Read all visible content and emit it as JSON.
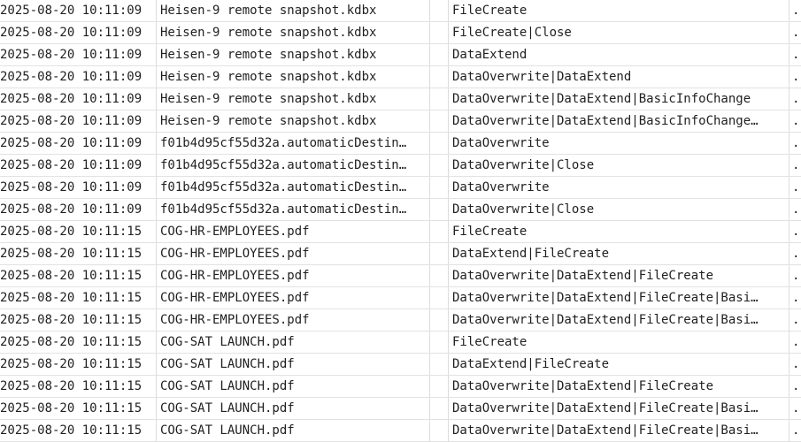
{
  "rows": [
    {
      "time": "2025-08-20 10:11:09",
      "file": "Heisen-9 remote snapshot.kdbx",
      "reason": "FileCreate",
      "more": "."
    },
    {
      "time": "2025-08-20 10:11:09",
      "file": "Heisen-9 remote snapshot.kdbx",
      "reason": "FileCreate|Close",
      "more": "."
    },
    {
      "time": "2025-08-20 10:11:09",
      "file": "Heisen-9 remote snapshot.kdbx",
      "reason": "DataExtend",
      "more": "."
    },
    {
      "time": "2025-08-20 10:11:09",
      "file": "Heisen-9 remote snapshot.kdbx",
      "reason": "DataOverwrite|DataExtend",
      "more": "."
    },
    {
      "time": "2025-08-20 10:11:09",
      "file": "Heisen-9 remote snapshot.kdbx",
      "reason": "DataOverwrite|DataExtend|BasicInfoChange",
      "more": "."
    },
    {
      "time": "2025-08-20 10:11:09",
      "file": "Heisen-9 remote snapshot.kdbx",
      "reason": "DataOverwrite|DataExtend|BasicInfoChange…",
      "more": "."
    },
    {
      "time": "2025-08-20 10:11:09",
      "file": "f01b4d95cf55d32a.automaticDestin…",
      "reason": "DataOverwrite",
      "more": "."
    },
    {
      "time": "2025-08-20 10:11:09",
      "file": "f01b4d95cf55d32a.automaticDestin…",
      "reason": "DataOverwrite|Close",
      "more": "."
    },
    {
      "time": "2025-08-20 10:11:09",
      "file": "f01b4d95cf55d32a.automaticDestin…",
      "reason": "DataOverwrite",
      "more": "."
    },
    {
      "time": "2025-08-20 10:11:09",
      "file": "f01b4d95cf55d32a.automaticDestin…",
      "reason": "DataOverwrite|Close",
      "more": "."
    },
    {
      "time": "2025-08-20 10:11:15",
      "file": "COG-HR-EMPLOYEES.pdf",
      "reason": "FileCreate",
      "more": "."
    },
    {
      "time": "2025-08-20 10:11:15",
      "file": "COG-HR-EMPLOYEES.pdf",
      "reason": "DataExtend|FileCreate",
      "more": "."
    },
    {
      "time": "2025-08-20 10:11:15",
      "file": "COG-HR-EMPLOYEES.pdf",
      "reason": "DataOverwrite|DataExtend|FileCreate",
      "more": "."
    },
    {
      "time": "2025-08-20 10:11:15",
      "file": "COG-HR-EMPLOYEES.pdf",
      "reason": "DataOverwrite|DataExtend|FileCreate|Basi…",
      "more": "."
    },
    {
      "time": "2025-08-20 10:11:15",
      "file": "COG-HR-EMPLOYEES.pdf",
      "reason": "DataOverwrite|DataExtend|FileCreate|Basi…",
      "more": "."
    },
    {
      "time": "2025-08-20 10:11:15",
      "file": "COG-SAT LAUNCH.pdf",
      "reason": "FileCreate",
      "more": "."
    },
    {
      "time": "2025-08-20 10:11:15",
      "file": "COG-SAT LAUNCH.pdf",
      "reason": "DataExtend|FileCreate",
      "more": "."
    },
    {
      "time": "2025-08-20 10:11:15",
      "file": "COG-SAT LAUNCH.pdf",
      "reason": "DataOverwrite|DataExtend|FileCreate",
      "more": "."
    },
    {
      "time": "2025-08-20 10:11:15",
      "file": "COG-SAT LAUNCH.pdf",
      "reason": "DataOverwrite|DataExtend|FileCreate|Basi…",
      "more": "."
    },
    {
      "time": "2025-08-20 10:11:15",
      "file": "COG-SAT LAUNCH.pdf",
      "reason": "DataOverwrite|DataExtend|FileCreate|Basi…",
      "more": "."
    }
  ]
}
